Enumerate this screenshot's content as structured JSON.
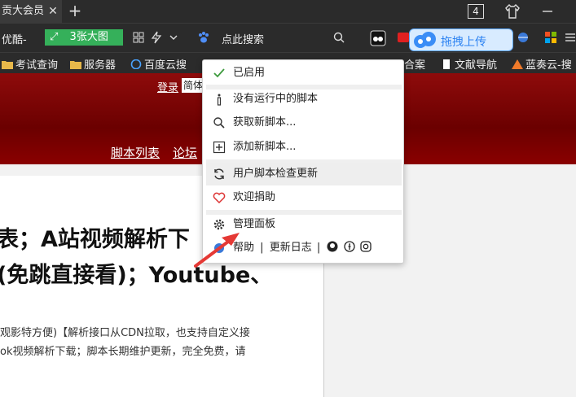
{
  "tabbar": {
    "active_tab": "贡大会员",
    "close": "✕",
    "new_tab": "+",
    "tab_count": "4"
  },
  "toolbar": {
    "left_text": "优酷-",
    "big_image_button": "3张大图",
    "search_label": "点此搜索",
    "upload_label": "拖拽上传"
  },
  "bookmarks": [
    "考试查询",
    "服务器",
    "百度云搜",
    "合案",
    "文献导航",
    "蓝奏云-搜"
  ],
  "page_header": {
    "login": "登录",
    "language": "简体",
    "nav": [
      "脚本列表",
      "论坛"
    ]
  },
  "content": {
    "title_line1": "表；A站视频解析下",
    "title_line2": "(免跳直接看)；Youtube、",
    "desc_line1": "观影特方便)【解析接口从CDN拉取，也支持自定义接",
    "desc_line2": "ok视频解析下载；脚本长期维护更新，完全免费，请"
  },
  "menu": {
    "enabled": "已启用",
    "no_script": "没有运行中的脚本",
    "get_script": "获取新脚本...",
    "add_script": "添加新脚本...",
    "check_update": "用户脚本检查更新",
    "donate": "欢迎捐助",
    "dashboard": "管理面板",
    "help": "帮助",
    "pipe1": "|",
    "changelog": "更新日志",
    "pipe2": "|"
  },
  "colors": {
    "accent_green": "#35b05a",
    "header_red": "#7a0000",
    "menu_check": "#3c9a3c",
    "arrow_red": "#e53935",
    "upload_blue": "#2b82f2"
  }
}
